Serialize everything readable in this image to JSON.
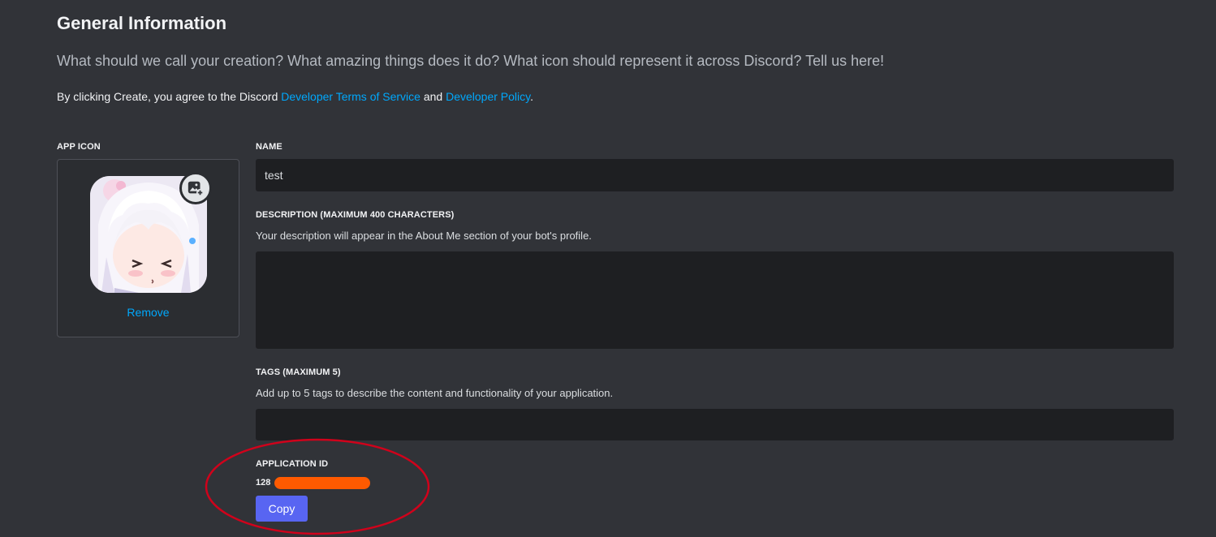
{
  "header": {
    "title": "General Information",
    "subtitle": "What should we call your creation? What amazing things does it do? What icon should represent it across Discord? Tell us here!",
    "terms_prefix": "By clicking Create, you agree to the Discord ",
    "terms_link": "Developer Terms of Service",
    "terms_and": " and ",
    "policy_link": "Developer Policy",
    "terms_suffix": "."
  },
  "app_icon": {
    "label": "APP ICON",
    "remove_label": "Remove",
    "upload_icon": "image-plus-icon"
  },
  "name_field": {
    "label": "NAME",
    "value": "test"
  },
  "description_field": {
    "label": "DESCRIPTION (MAXIMUM 400 CHARACTERS)",
    "helper": "Your description will appear in the About Me section of your bot's profile.",
    "value": ""
  },
  "tags_field": {
    "label": "TAGS (MAXIMUM 5)",
    "helper": "Add up to 5 tags to describe the content and functionality of your application.",
    "value": ""
  },
  "application_id": {
    "label": "APPLICATION ID",
    "value_visible": "128",
    "copy_label": "Copy"
  },
  "colors": {
    "background": "#313338",
    "input": "#1e1f22",
    "link": "#00a8fc",
    "button": "#5865f2",
    "redaction": "#ff5a00",
    "annotation": "#d0021b"
  }
}
